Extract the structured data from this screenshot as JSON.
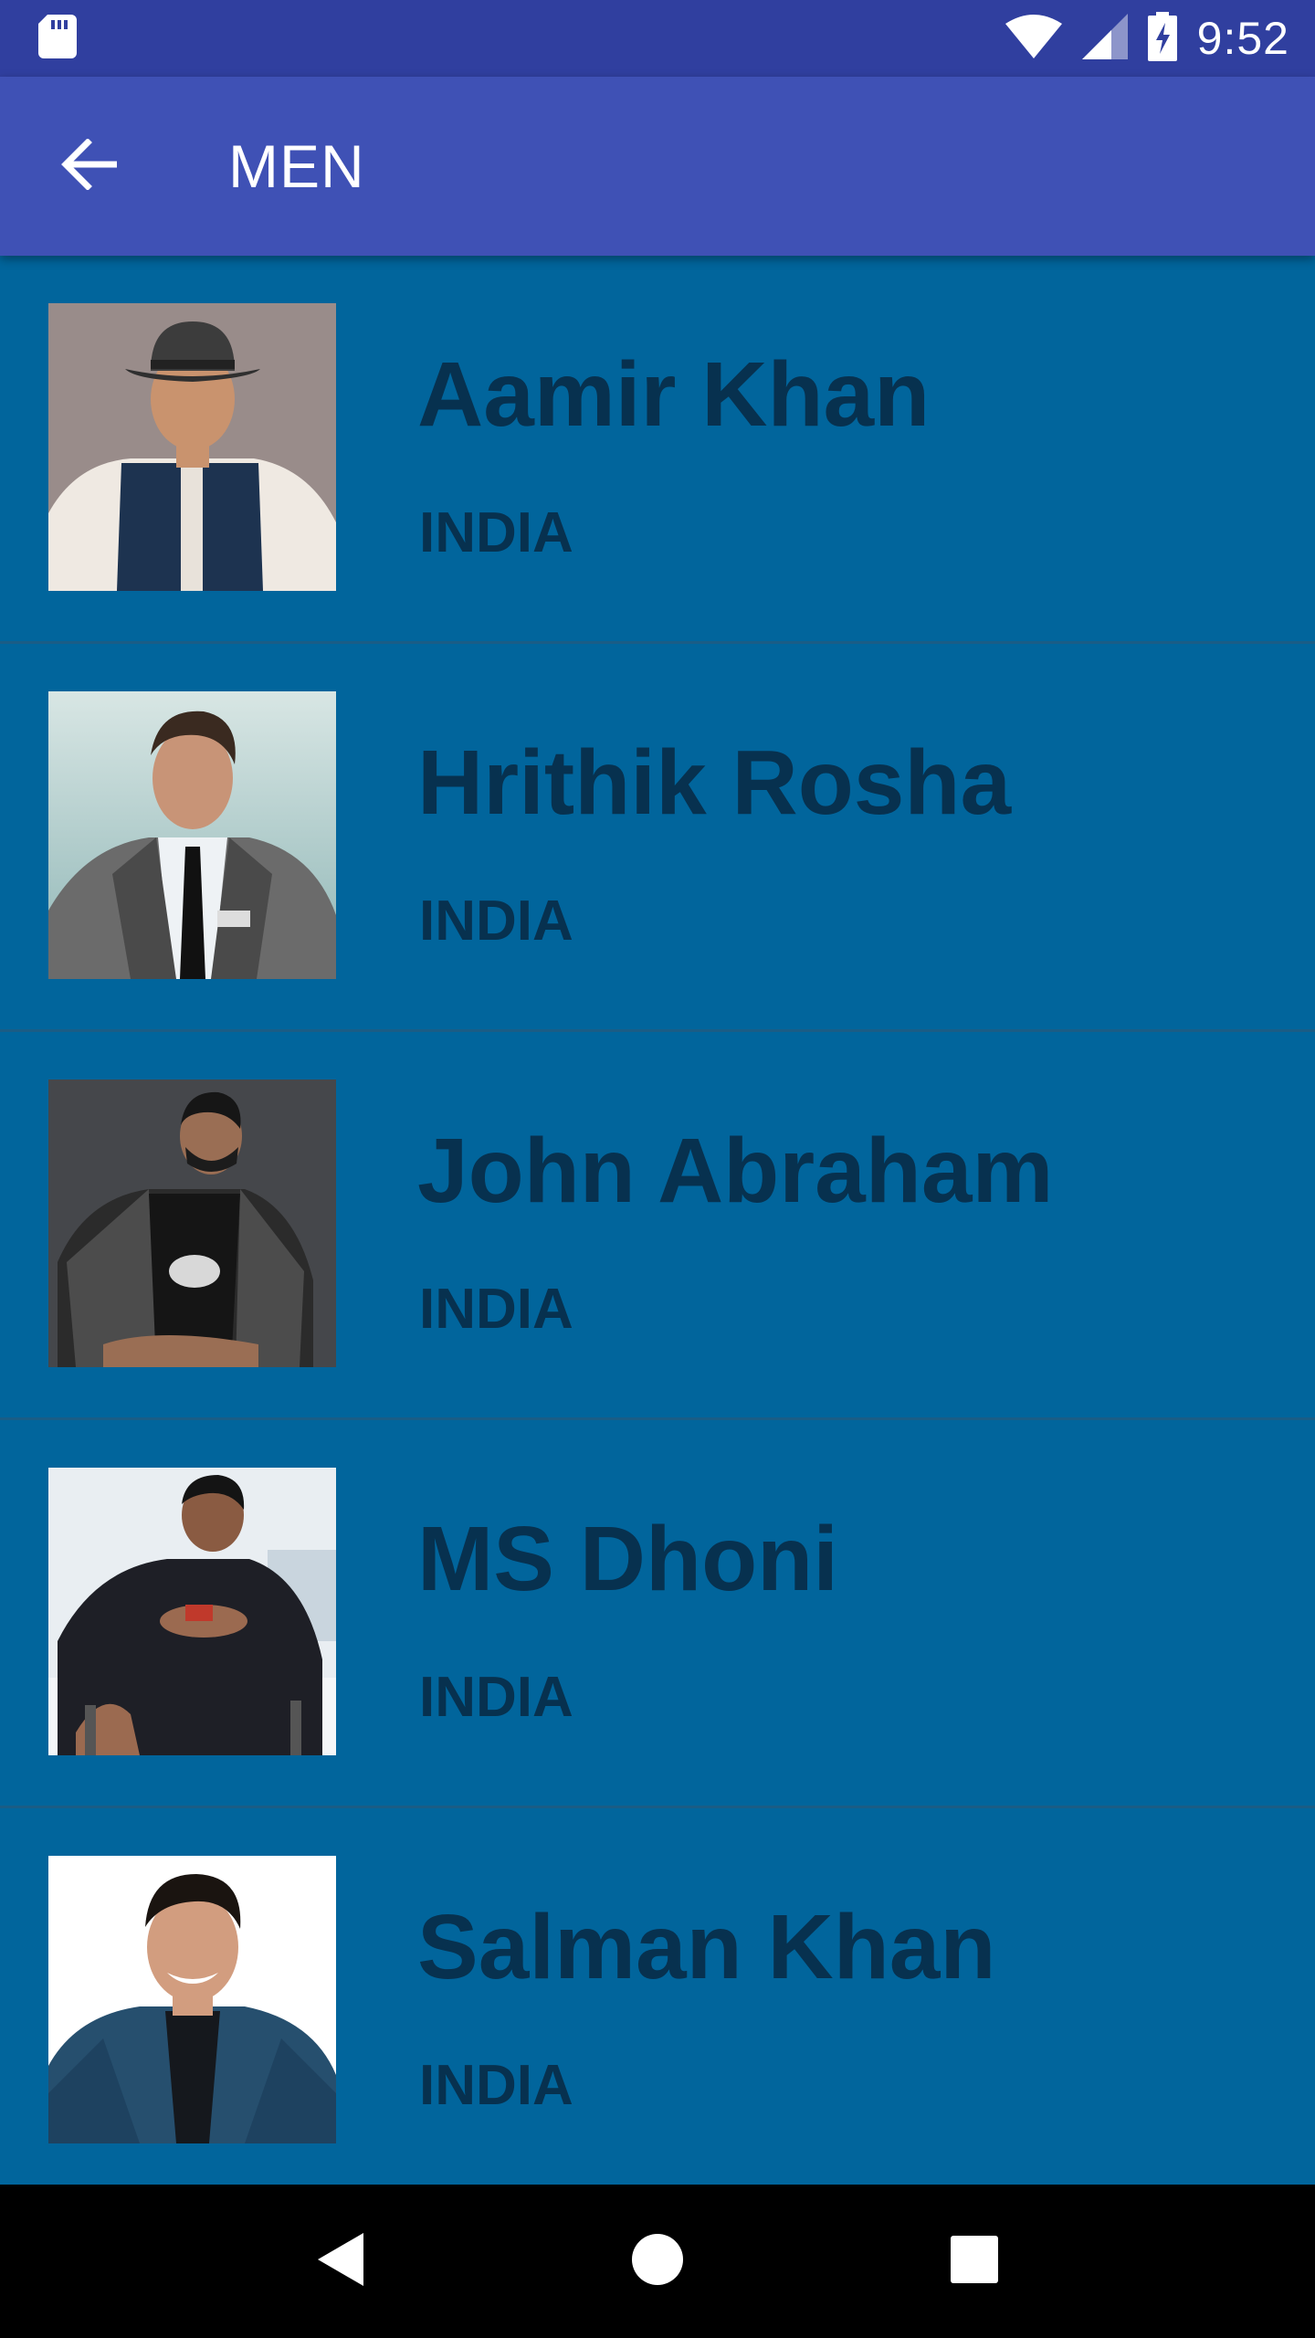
{
  "status_bar": {
    "time": "9:52"
  },
  "app_bar": {
    "title": "MEN"
  },
  "people": [
    {
      "name": "Aamir Khan",
      "country": "INDIA"
    },
    {
      "name": "Hrithik Rosha",
      "country": "INDIA"
    },
    {
      "name": "John Abraham",
      "country": "INDIA"
    },
    {
      "name": "MS Dhoni",
      "country": "INDIA"
    },
    {
      "name": "Salman Khan",
      "country": "INDIA"
    }
  ],
  "colors": {
    "status_bar": "#303F9F",
    "app_bar": "#3F51B5",
    "list_background": "#01659C",
    "item_text": "#07314F"
  },
  "icons": {
    "sd_card": "sd-card-icon",
    "wifi": "wifi-icon",
    "signal": "signal-icon",
    "battery": "battery-charging-icon",
    "back": "arrow-back-icon",
    "nav_back": "nav-back-icon",
    "nav_home": "nav-home-icon",
    "nav_recents": "nav-recents-icon"
  }
}
